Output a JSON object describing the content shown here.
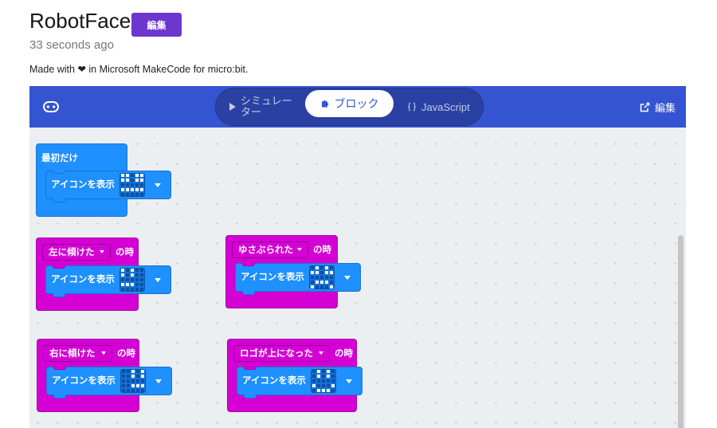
{
  "page": {
    "title": "RobotFace",
    "edit_button": "編集",
    "timestamp": "33 seconds ago",
    "made_with": "Made with ❤ in Microsoft MakeCode for micro:bit."
  },
  "editor": {
    "header": {
      "logo_icon": "microbit-logo-icon",
      "tabs": [
        {
          "label": "シミュレーター",
          "icon": "play-icon",
          "selected": false
        },
        {
          "label": "ブロック",
          "icon": "puzzle-icon",
          "selected": true
        },
        {
          "label": "JavaScript",
          "icon": "braces-icon",
          "selected": false
        }
      ],
      "edit_link": {
        "label": "編集",
        "icon": "external-link-icon"
      }
    },
    "blocks": [
      {
        "label": "最初だけ",
        "statement": {
          "label": "アイコンを表示",
          "leds": [
            [
              1,
              1,
              0,
              1,
              1
            ],
            [
              1,
              1,
              0,
              1,
              1
            ],
            [
              0,
              0,
              0,
              0,
              0
            ],
            [
              1,
              1,
              1,
              1,
              1
            ],
            [
              0,
              0,
              0,
              0,
              0
            ]
          ]
        }
      },
      {
        "gesture": "左に傾けた",
        "suffix": "の時",
        "statement": {
          "label": "アイコンを表示",
          "leds": [
            [
              1,
              0,
              1,
              0,
              0
            ],
            [
              1,
              0,
              1,
              0,
              0
            ],
            [
              0,
              0,
              0,
              0,
              0
            ],
            [
              1,
              1,
              1,
              0,
              0
            ],
            [
              0,
              0,
              0,
              0,
              0
            ]
          ]
        }
      },
      {
        "gesture": "ゆさぶられた",
        "suffix": "の時",
        "statement": {
          "label": "アイコンを表示",
          "leds": [
            [
              0,
              1,
              0,
              1,
              0
            ],
            [
              1,
              1,
              0,
              1,
              1
            ],
            [
              0,
              0,
              0,
              0,
              0
            ],
            [
              0,
              1,
              1,
              1,
              0
            ],
            [
              1,
              0,
              0,
              0,
              1
            ]
          ]
        }
      },
      {
        "gesture": "右に傾けた",
        "suffix": "の時",
        "statement": {
          "label": "アイコンを表示",
          "leds": [
            [
              0,
              0,
              1,
              0,
              1
            ],
            [
              0,
              0,
              1,
              0,
              1
            ],
            [
              0,
              0,
              0,
              0,
              0
            ],
            [
              0,
              0,
              1,
              1,
              1
            ],
            [
              0,
              0,
              0,
              0,
              0
            ]
          ]
        }
      },
      {
        "gesture": "ロゴが上になった",
        "suffix": "の時",
        "statement": {
          "label": "アイコンを表示",
          "leds": [
            [
              0,
              1,
              0,
              1,
              0
            ],
            [
              0,
              1,
              0,
              1,
              0
            ],
            [
              0,
              0,
              0,
              0,
              0
            ],
            [
              1,
              0,
              0,
              0,
              1
            ],
            [
              0,
              1,
              1,
              1,
              0
            ]
          ]
        }
      }
    ]
  },
  "colors": {
    "edit_button": "#6d36cf",
    "header": "#3454d1",
    "mode_toggle": "#2a41a3",
    "basic_block": "#1e90ff",
    "input_block": "#d400d4",
    "workspace": "#eceff1"
  }
}
